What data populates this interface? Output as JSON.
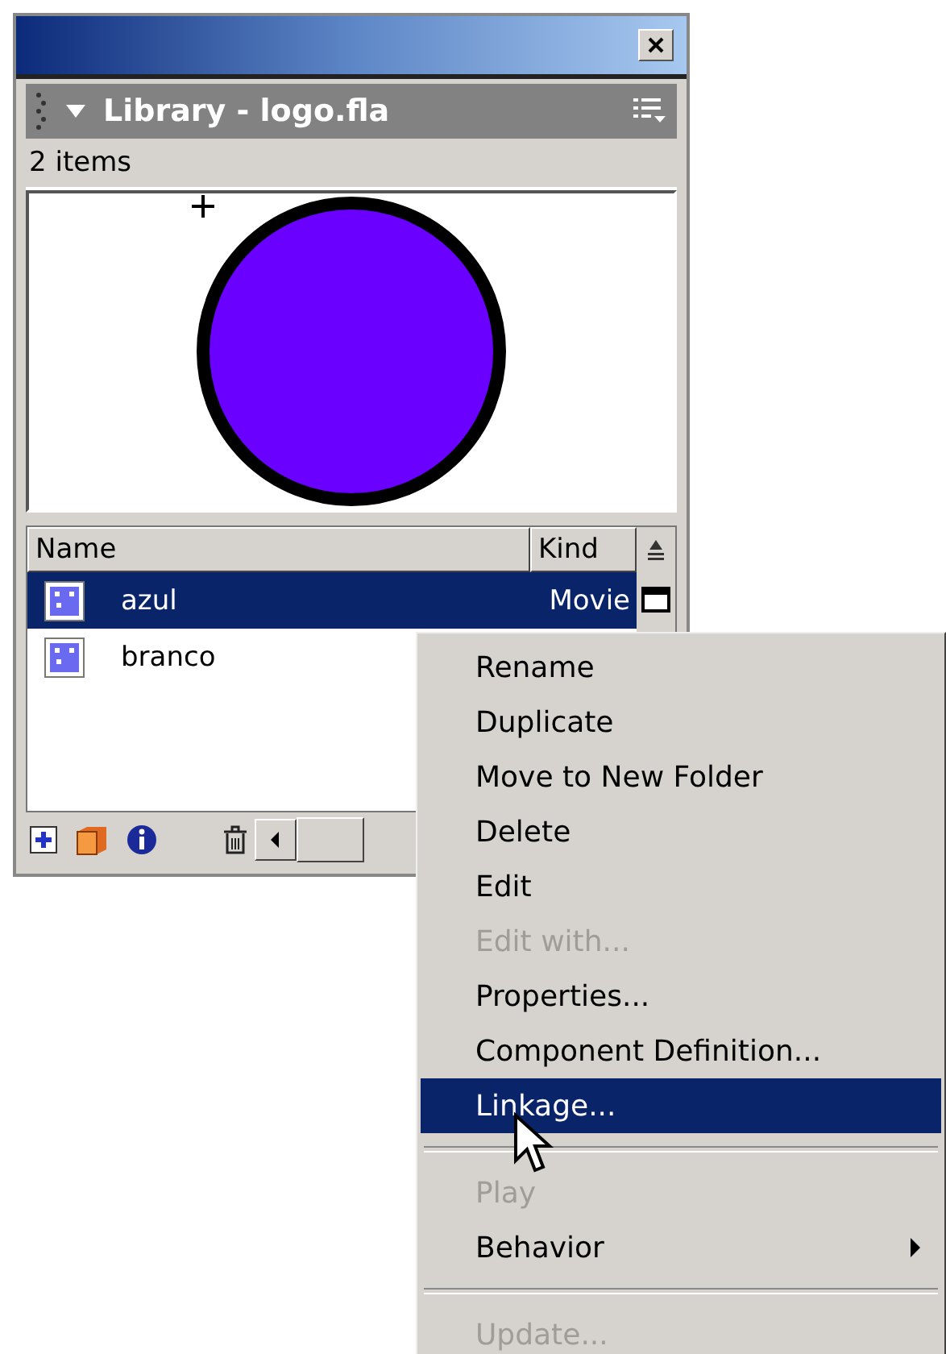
{
  "panel": {
    "title": "Library - logo.fla",
    "item_count": "2 items",
    "columns": [
      {
        "label": "Name"
      },
      {
        "label": "Kind"
      }
    ],
    "items": [
      {
        "name": "azul",
        "kind": "Movie",
        "selected": true
      },
      {
        "name": "branco",
        "selected": false
      }
    ]
  },
  "context_menu": {
    "items": [
      {
        "kind": "item",
        "label": "Rename",
        "disabled": false,
        "selected": false
      },
      {
        "kind": "item",
        "label": "Duplicate",
        "disabled": false,
        "selected": false
      },
      {
        "kind": "item",
        "label": "Move to New Folder",
        "disabled": false,
        "selected": false
      },
      {
        "kind": "item",
        "label": "Delete",
        "disabled": false,
        "selected": false
      },
      {
        "kind": "item",
        "label": "Edit",
        "disabled": false,
        "selected": false
      },
      {
        "kind": "item",
        "label": "Edit with...",
        "disabled": true,
        "selected": false
      },
      {
        "kind": "item",
        "label": "Properties...",
        "disabled": false,
        "selected": false
      },
      {
        "kind": "item",
        "label": "Component Definition...",
        "disabled": false,
        "selected": false
      },
      {
        "kind": "item",
        "label": "Linkage...",
        "disabled": false,
        "selected": true
      },
      {
        "kind": "separator"
      },
      {
        "kind": "item",
        "label": "Play",
        "disabled": true,
        "selected": false
      },
      {
        "kind": "submenu",
        "label": "Behavior",
        "disabled": false,
        "selected": false
      },
      {
        "kind": "separator"
      },
      {
        "kind": "item",
        "label": "Update...",
        "disabled": true,
        "selected": false
      }
    ]
  }
}
